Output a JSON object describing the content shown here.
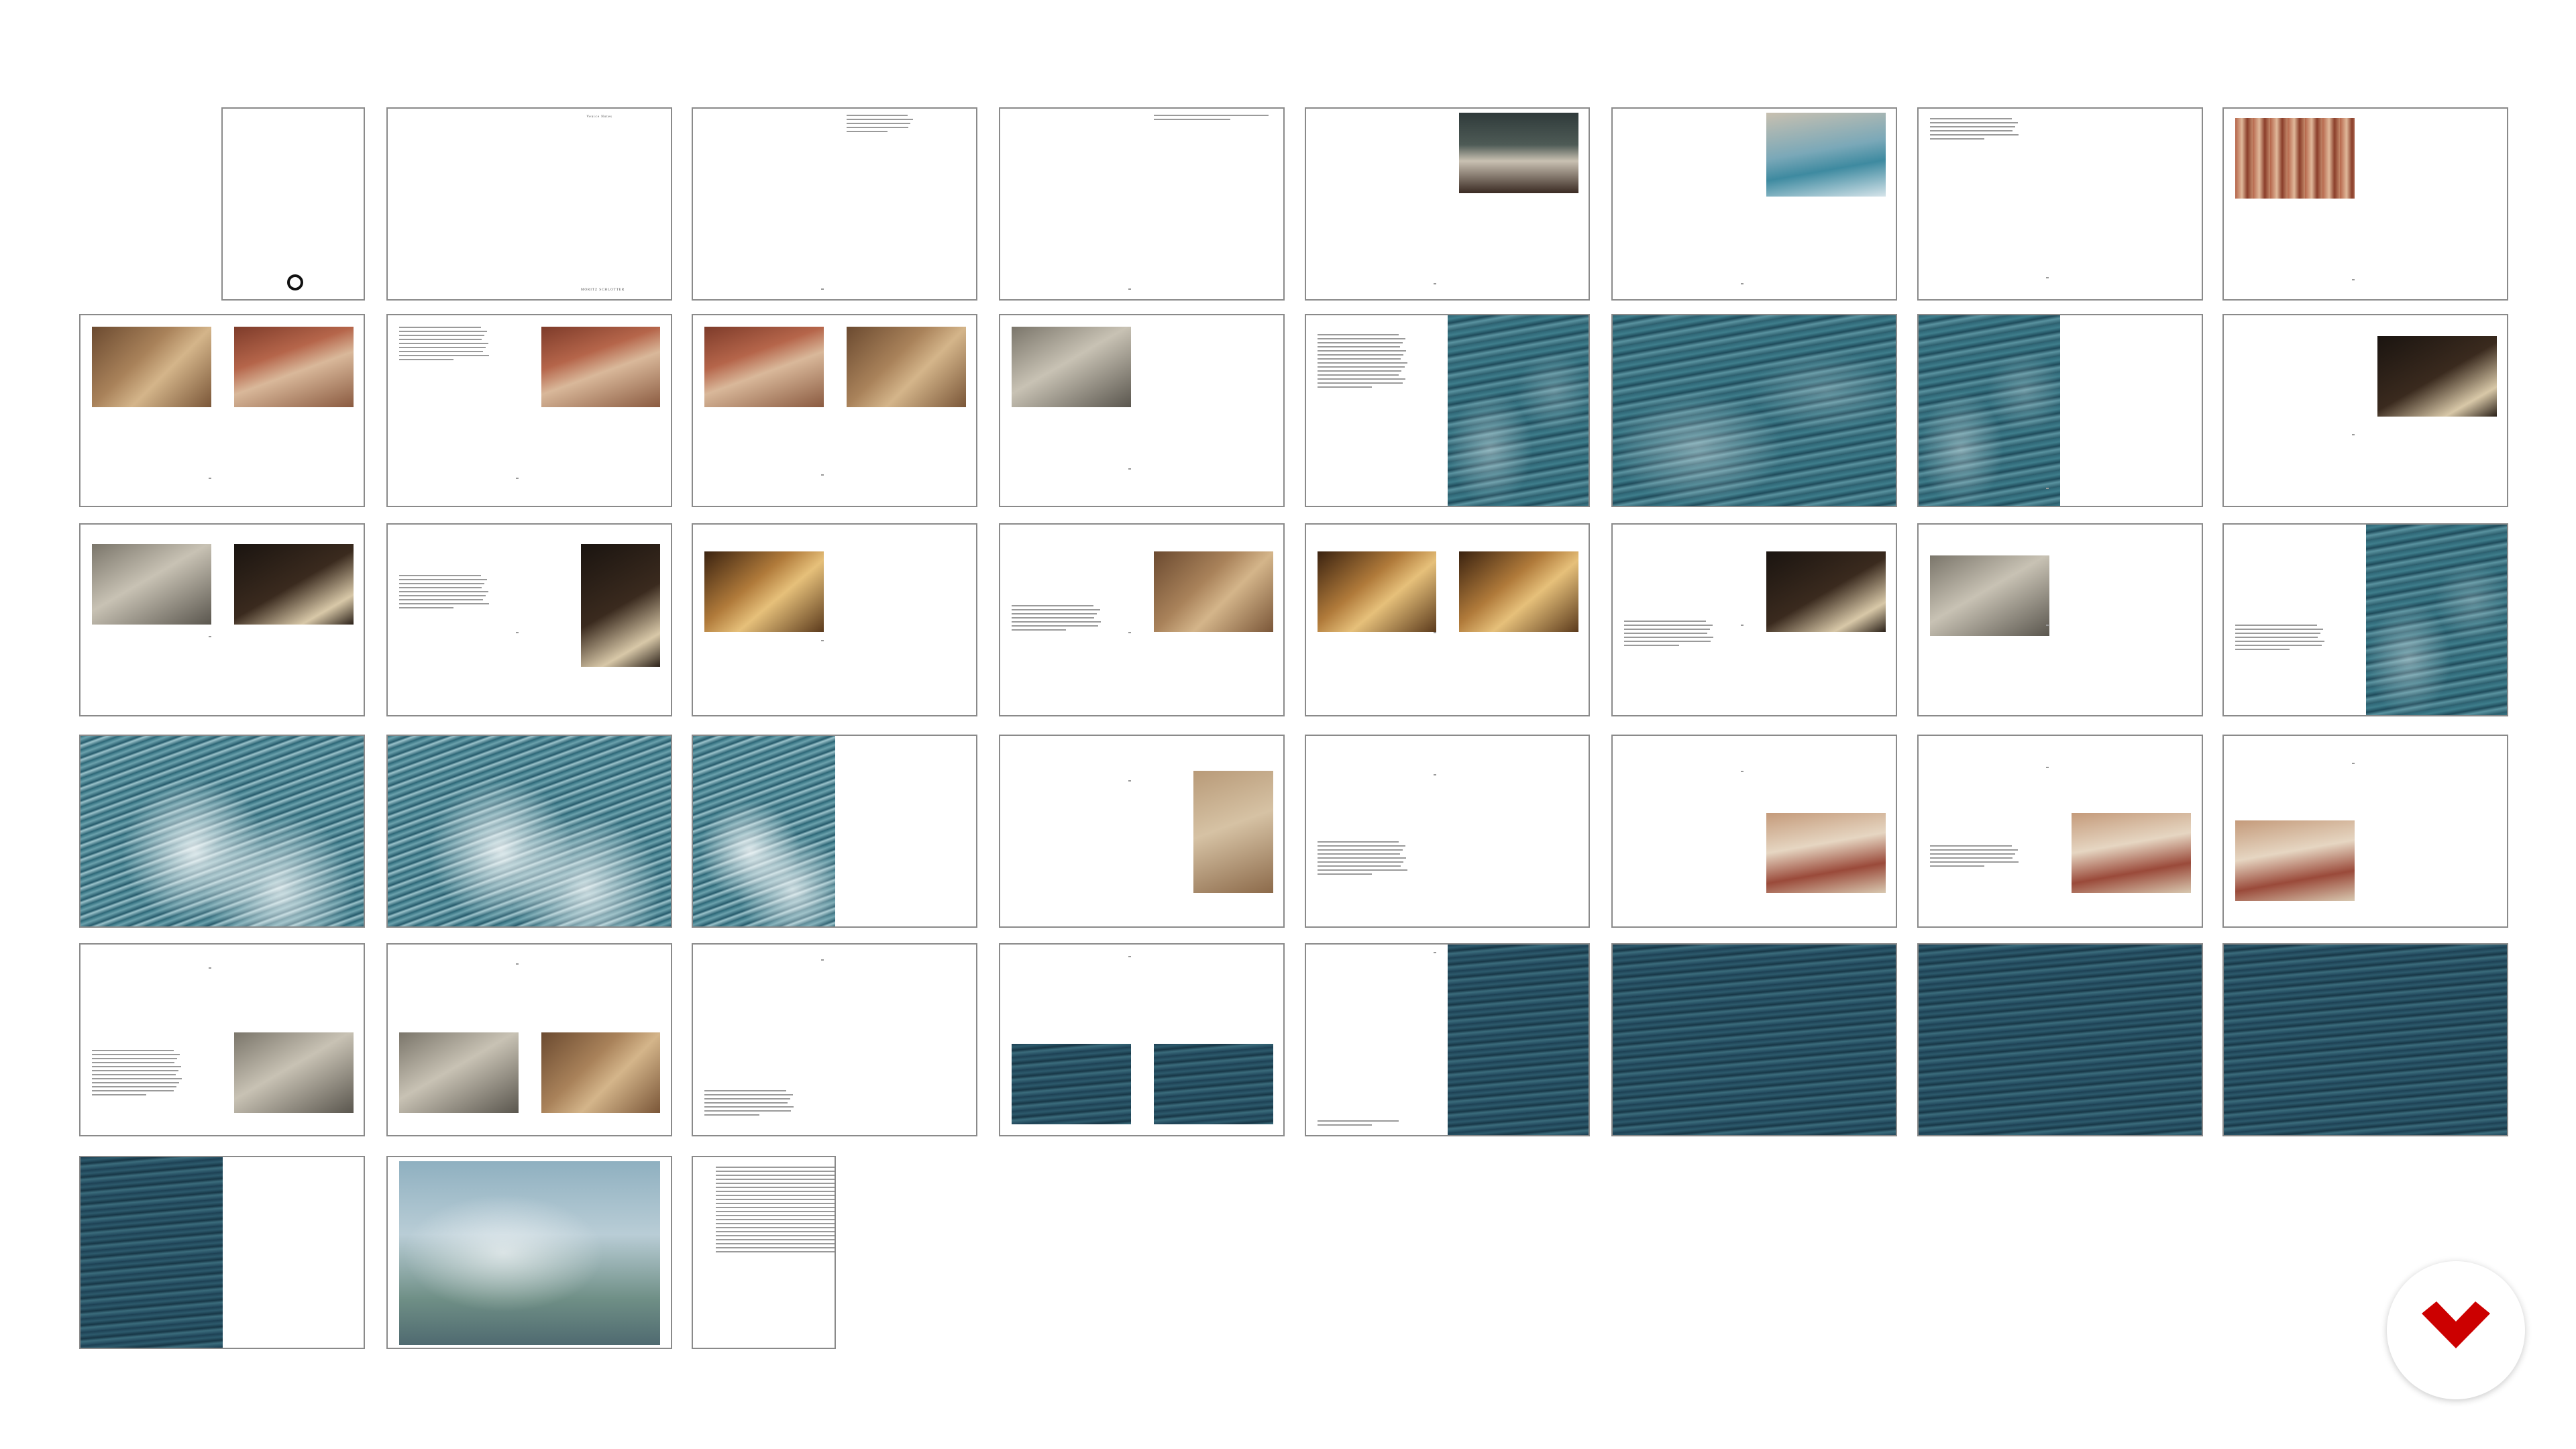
{
  "board": {
    "title_page_text": "Venice Notes",
    "title_page_footer": "MORITZ SCHLOTTER"
  },
  "colors": {
    "page_border": "#8a8a8a",
    "background": "#ffffff",
    "logo": "#cc0000",
    "sea_dark": "#1e4a5a",
    "sea_light": "#4e8a98"
  },
  "logo": {
    "icon": "red-chevron-logo-icon"
  }
}
